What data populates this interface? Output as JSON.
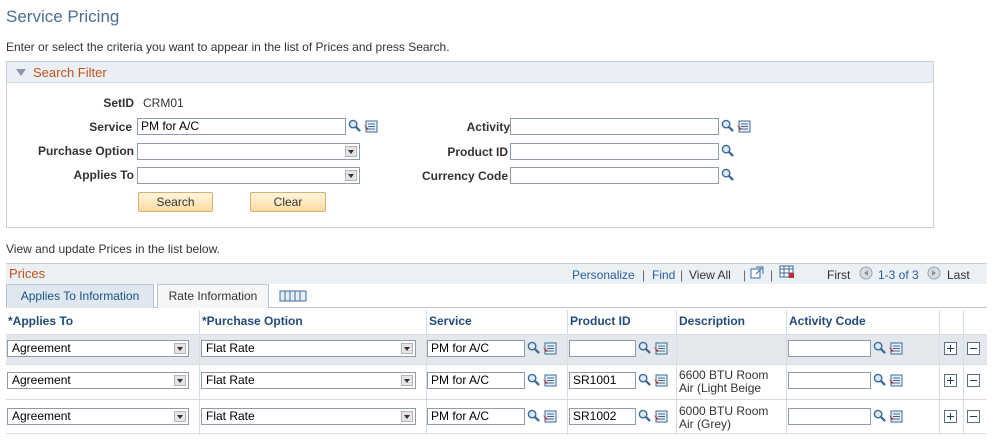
{
  "page": {
    "title": "Service Pricing",
    "instructions": "Enter or select the criteria you want to appear in the list of Prices and press Search."
  },
  "filter": {
    "title": "Search Filter",
    "setid_label": "SetID",
    "setid_value": "CRM01",
    "service_label": "Service",
    "service_value": "PM for A/C",
    "purchase_option_label": "Purchase Option",
    "purchase_option_value": "",
    "applies_to_label": "Applies To",
    "applies_to_value": "",
    "activity_label": "Activity",
    "activity_value": "",
    "product_id_label": "Product ID",
    "product_id_value": "",
    "currency_code_label": "Currency Code",
    "currency_code_value": "",
    "search_button": "Search",
    "clear_button": "Clear"
  },
  "list_instructions": "View and update Prices in the list below.",
  "grid": {
    "title": "Prices",
    "personalize": "Personalize",
    "find": "Find",
    "view_all": "View All",
    "first": "First",
    "range": "1-3 of 3",
    "last": "Last",
    "tabs": [
      "Applies To Information",
      "Rate Information"
    ],
    "columns": [
      "*Applies To",
      "*Purchase Option",
      "Service",
      "Product ID",
      "Description",
      "Activity Code"
    ],
    "rows": [
      {
        "applies_to": "Agreement",
        "purchase_option": "Flat Rate",
        "service": "PM for A/C",
        "product_id": "",
        "description_1": "",
        "description_2": "",
        "activity_code": ""
      },
      {
        "applies_to": "Agreement",
        "purchase_option": "Flat Rate",
        "service": "PM for A/C",
        "product_id": "SR1001",
        "description_1": "6600 BTU Room",
        "description_2": "Air (Light Beige",
        "activity_code": ""
      },
      {
        "applies_to": "Agreement",
        "purchase_option": "Flat Rate",
        "service": "PM for A/C",
        "product_id": "SR1002",
        "description_1": "6000 BTU Room",
        "description_2": "Air (Grey)",
        "activity_code": ""
      }
    ]
  },
  "colors": {
    "title_blue": "#4a6e94",
    "section_orange": "#c2521a",
    "link_blue": "#2b5d9b",
    "header_bg": "#ebf0f5",
    "row_highlight": "#e4e8ec"
  }
}
